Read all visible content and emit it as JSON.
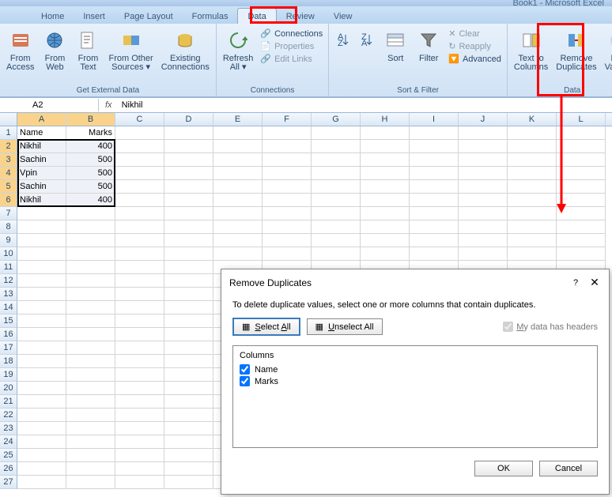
{
  "title_suffix": "Book1 - Microsoft Excel",
  "tabs": [
    "Home",
    "Insert",
    "Page Layout",
    "Formulas",
    "Data",
    "Review",
    "View"
  ],
  "active_tab": "Data",
  "ribbon": {
    "external": {
      "label": "Get External Data",
      "access": "From\nAccess",
      "web": "From\nWeb",
      "text": "From\nText",
      "other": "From Other\nSources ▾",
      "existing": "Existing\nConnections"
    },
    "conn": {
      "label": "Connections",
      "refresh": "Refresh\nAll ▾",
      "connections": "Connections",
      "properties": "Properties",
      "editlinks": "Edit Links"
    },
    "sort": {
      "label": "Sort & Filter",
      "sort": "Sort",
      "filter": "Filter",
      "clear": "Clear",
      "reapply": "Reapply",
      "advanced": "Advanced"
    },
    "data": {
      "label": "Data",
      "ttc": "Text to\nColumns",
      "rd": "Remove\nDuplicates",
      "dv": "Dat\nValidat"
    }
  },
  "namebox": "A2",
  "formula": "Nikhil",
  "cols": [
    "A",
    "B",
    "C",
    "D",
    "E",
    "F",
    "G",
    "H",
    "I",
    "J",
    "K",
    "L"
  ],
  "sheet": {
    "headers": [
      "Name",
      "Marks"
    ],
    "rows": [
      [
        "Nikhil",
        "400"
      ],
      [
        "Sachin",
        "500"
      ],
      [
        "Vpin",
        "500"
      ],
      [
        "Sachin",
        "500"
      ],
      [
        "Nikhil",
        "400"
      ]
    ]
  },
  "dialog": {
    "title": "Remove Duplicates",
    "msg": "To delete duplicate values, select one or more columns that contain duplicates.",
    "select_all": "Select All",
    "unselect_all": "Unselect All",
    "headers_chk": "My data has headers",
    "cols_hdr": "Columns",
    "cols": [
      "Name",
      "Marks"
    ],
    "ok": "OK",
    "cancel": "Cancel"
  }
}
